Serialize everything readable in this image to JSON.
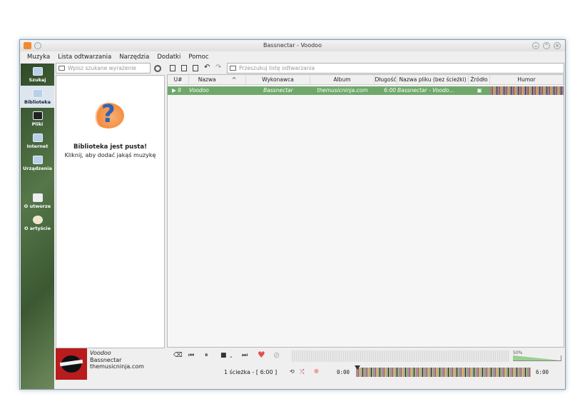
{
  "window": {
    "title": "Bassnectar - Voodoo"
  },
  "menu": [
    "Muzyka",
    "Lista odtwarzania",
    "Narzędzia",
    "Dodatki",
    "Pomoc"
  ],
  "sidebar": {
    "items": [
      {
        "label": "Szukaj",
        "icon": "search-icon"
      },
      {
        "label": "Biblioteka",
        "icon": "library-icon",
        "active": true
      },
      {
        "label": "Pliki",
        "icon": "files-icon"
      },
      {
        "label": "Internet",
        "icon": "internet-icon"
      },
      {
        "label": "Urządzenia",
        "icon": "devices-icon"
      },
      {
        "label": "O utworze",
        "icon": "song-info-icon"
      },
      {
        "label": "O artyście",
        "icon": "artist-info-icon"
      }
    ]
  },
  "library": {
    "search_placeholder": "Wpisz szukane wyrażenie",
    "empty_title": "Biblioteka jest pusta!",
    "empty_hint": "Kliknij, aby dodać jakąś muzykę"
  },
  "playlist": {
    "search_placeholder": "Przeszukuj listę odtwarzania",
    "columns": [
      "U#",
      "Nazwa",
      "Wykonawca",
      "Album",
      "Długość",
      "Nazwa pliku (bez ścieżki)",
      "Źródło",
      "Humor"
    ],
    "rows": [
      {
        "track": "9",
        "title": "Voodoo",
        "artist": "Bassnectar",
        "album": "themusicninja.com",
        "length": "6:00",
        "filename": "Bassnectar - Voodo..."
      }
    ]
  },
  "now_playing": {
    "title": "Voodoo",
    "artist": "Bassnectar",
    "album": "themusicninja.com"
  },
  "volume": {
    "label": "50%",
    "level": 0.5
  },
  "status": {
    "text": "1 ścieżka - [ 6:00 ]",
    "elapsed": "0:00",
    "total": "6:00"
  }
}
